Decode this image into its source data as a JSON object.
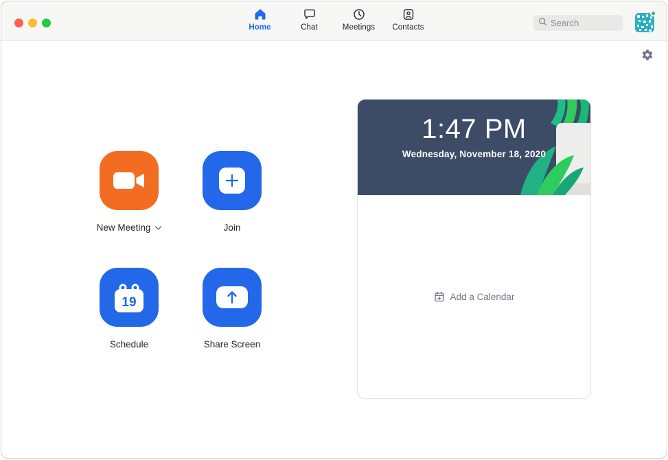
{
  "header": {
    "traffic_lights": {
      "close": "close",
      "minimize": "minimize",
      "fullscreen": "fullscreen"
    },
    "tabs": [
      {
        "label": "Home",
        "icon": "home-icon",
        "active": true
      },
      {
        "label": "Chat",
        "icon": "chat-bubble-icon",
        "active": false
      },
      {
        "label": "Meetings",
        "icon": "clock-icon",
        "active": false
      },
      {
        "label": "Contacts",
        "icon": "contact-card-icon",
        "active": false
      }
    ],
    "search": {
      "placeholder": "Search",
      "icon": "search-icon"
    },
    "avatar": {
      "icon": "avatar-mosaic",
      "status": "online"
    }
  },
  "settings": {
    "icon": "gear-icon"
  },
  "actions": [
    {
      "label": "New Meeting",
      "icon": "video-camera-icon",
      "color": "#F26D21",
      "has_dropdown": true
    },
    {
      "label": "Join",
      "icon": "plus-icon",
      "color": "#2268E8"
    },
    {
      "label": "Schedule",
      "icon": "calendar-icon",
      "calendar_day": "19",
      "color": "#2268E8"
    },
    {
      "label": "Share Screen",
      "icon": "arrow-up-icon",
      "color": "#2268E8"
    }
  ],
  "panel": {
    "time": "1:47 PM",
    "date": "Wednesday, November 18, 2020",
    "add_calendar": {
      "label": "Add a Calendar",
      "icon": "calendar-plus-icon"
    }
  },
  "colors": {
    "accent_blue": "#2268E8",
    "accent_orange": "#F26D21",
    "hero_navy": "#3D4C66",
    "active_tab_blue": "#1F6BE8",
    "online_green": "#23C552"
  }
}
